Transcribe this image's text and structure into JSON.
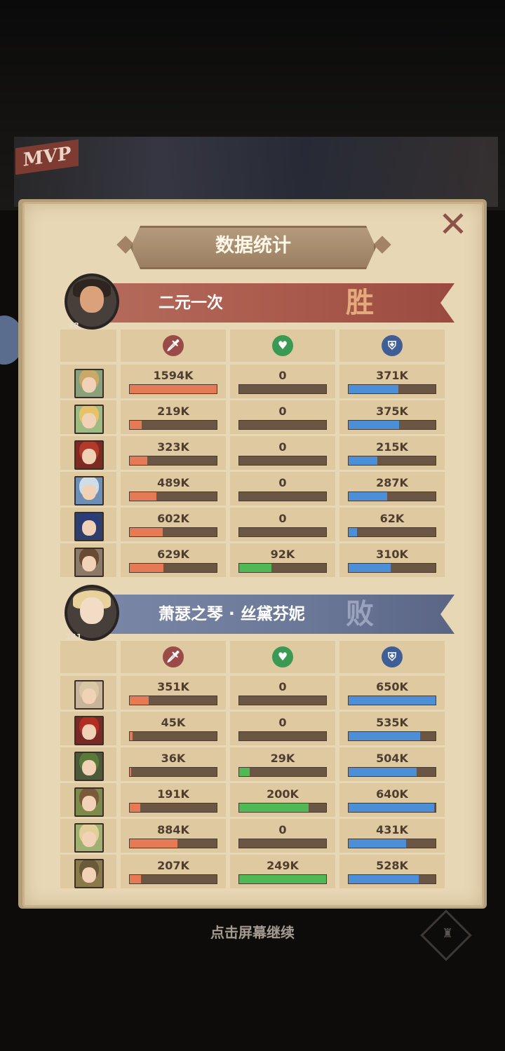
{
  "mvp_label": "MVP",
  "title": "数据统计",
  "close_icon": "✕",
  "continue_hint": "点击屏幕继续",
  "colors": {
    "damage": "#e57a55",
    "healing": "#4fba55",
    "tanking": "#4c8fd6",
    "win_banner": "#a8584a",
    "lose_banner": "#6b7797"
  },
  "stat_headers": [
    {
      "icon": "sword-icon",
      "glyph": "🗡",
      "color": "#9b4b47"
    },
    {
      "icon": "heal-heart-icon",
      "glyph": "♥",
      "color": "#3a9a53"
    },
    {
      "icon": "shield-icon",
      "glyph": "⛨",
      "color": "#3f5e96"
    }
  ],
  "teams": [
    {
      "name": "二元一次",
      "result": "胜",
      "level": "48",
      "heroes": [
        {
          "damage": "1594K",
          "damage_pct": 100,
          "healing": "0",
          "healing_pct": 0,
          "tanking": "371K",
          "tanking_pct": 57,
          "hair": "#c9a86a",
          "bg": "#8aa27c"
        },
        {
          "damage": "219K",
          "damage_pct": 14,
          "healing": "0",
          "healing_pct": 0,
          "tanking": "375K",
          "tanking_pct": 58,
          "hair": "#e6c36b",
          "bg": "#9dbb83"
        },
        {
          "damage": "323K",
          "damage_pct": 20,
          "healing": "0",
          "healing_pct": 0,
          "tanking": "215K",
          "tanking_pct": 33,
          "hair": "#b13a2d",
          "bg": "#7e2a22"
        },
        {
          "damage": "489K",
          "damage_pct": 31,
          "healing": "0",
          "healing_pct": 0,
          "tanking": "287K",
          "tanking_pct": 44,
          "hair": "#cfdde8",
          "bg": "#6d8fb5"
        },
        {
          "damage": "602K",
          "damage_pct": 38,
          "healing": "0",
          "healing_pct": 0,
          "tanking": "62K",
          "tanking_pct": 10,
          "hair": "#2b3c78",
          "bg": "#2f3f6b"
        },
        {
          "damage": "629K",
          "damage_pct": 39,
          "healing": "92K",
          "healing_pct": 37,
          "tanking": "310K",
          "tanking_pct": 48,
          "hair": "#6b4a33",
          "bg": "#8c7a68"
        }
      ]
    },
    {
      "name": "萧瑟之琴 · 丝黛芬妮",
      "result": "败",
      "level": "141",
      "heroes": [
        {
          "damage": "351K",
          "damage_pct": 22,
          "healing": "0",
          "healing_pct": 0,
          "tanking": "650K",
          "tanking_pct": 100,
          "hair": "#d8c6a5",
          "bg": "#c8b49a"
        },
        {
          "damage": "45K",
          "damage_pct": 3,
          "healing": "0",
          "healing_pct": 0,
          "tanking": "535K",
          "tanking_pct": 82,
          "hair": "#b22e22",
          "bg": "#7a2a25"
        },
        {
          "damage": "36K",
          "damage_pct": 2,
          "healing": "29K",
          "healing_pct": 12,
          "tanking": "504K",
          "tanking_pct": 78,
          "hair": "#5b7a3a",
          "bg": "#4c5a3a"
        },
        {
          "damage": "191K",
          "damage_pct": 12,
          "healing": "200K",
          "healing_pct": 80,
          "tanking": "640K",
          "tanking_pct": 98,
          "hair": "#7a5a3a",
          "bg": "#7c8a4a"
        },
        {
          "damage": "884K",
          "damage_pct": 55,
          "healing": "0",
          "healing_pct": 0,
          "tanking": "431K",
          "tanking_pct": 66,
          "hair": "#e2cf9b",
          "bg": "#9fb070"
        },
        {
          "damage": "207K",
          "damage_pct": 13,
          "healing": "249K",
          "healing_pct": 100,
          "tanking": "528K",
          "tanking_pct": 81,
          "hair": "#6b5a3a",
          "bg": "#8a7a4a"
        }
      ]
    }
  ]
}
